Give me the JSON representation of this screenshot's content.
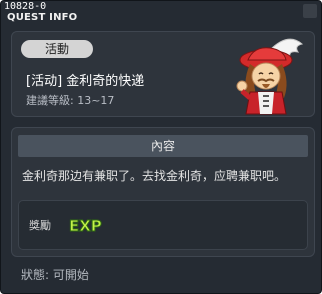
{
  "window": {
    "quest_id": "10828-0",
    "title": "QUEST INFO"
  },
  "quest": {
    "category": "活動",
    "name": "[活动] 金利奇的快递",
    "level_range": "建議等級: 13~17",
    "npc_icon": "npc-portrait"
  },
  "content": {
    "header": "內容",
    "body": "金利奇那边有兼职了。去找金利奇，应聘兼职吧。"
  },
  "reward": {
    "label": "獎勵",
    "exp_label": "EXP",
    "exp_icon": "exp-icon"
  },
  "status": {
    "text": "狀態:  可開始"
  }
}
